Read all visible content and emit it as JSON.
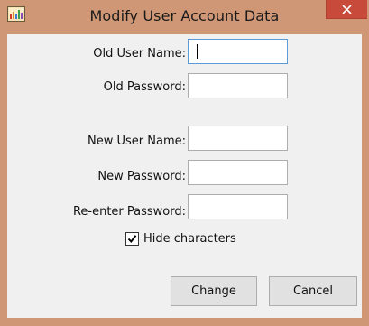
{
  "window": {
    "title": "Modify User Account Data",
    "app_icon": "chart-image-icon",
    "close_icon": "close-icon"
  },
  "form": {
    "old_user_name_label": "Old User Name:",
    "old_user_name_value": "",
    "old_password_label": "Old Password:",
    "old_password_value": "",
    "new_user_name_label": "New User Name:",
    "new_user_name_value": "",
    "new_password_label": "New Password:",
    "new_password_value": "",
    "reenter_password_label": "Re-enter Password:",
    "reenter_password_value": "",
    "hide_characters_label": "Hide characters",
    "hide_characters_checked": true
  },
  "buttons": {
    "change_label": "Change",
    "cancel_label": "Cancel"
  },
  "colors": {
    "frame": "#cf9775",
    "close_button": "#c74a3b",
    "focus_border": "#5b9bd5",
    "dialog_background": "#f0f0f0"
  }
}
